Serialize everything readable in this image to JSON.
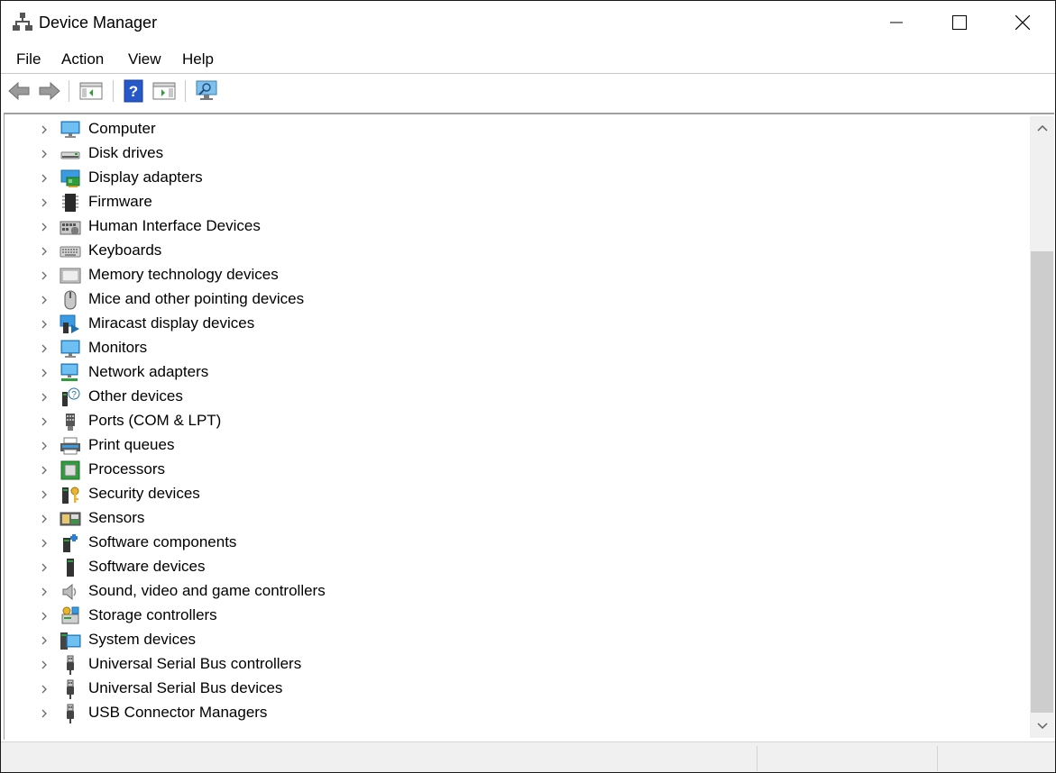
{
  "window": {
    "title": "Device Manager"
  },
  "menu": {
    "file": "File",
    "action": "Action",
    "view": "View",
    "help": "Help"
  },
  "icons": {
    "app": "device-manager-icon",
    "toolbar": [
      "back-arrow-icon",
      "forward-arrow-icon",
      "show-hide-console-tree-icon",
      "help-icon",
      "action-pane-icon",
      "scan-hardware-changes-icon"
    ]
  },
  "colors": {
    "thumb": "#cdcdcd",
    "scroll_track": "#f0f0f0",
    "icon_blue": "#2b7cd3"
  },
  "tree": {
    "items": [
      {
        "label": "Computer",
        "icon": "computer"
      },
      {
        "label": "Disk drives",
        "icon": "disk"
      },
      {
        "label": "Display adapters",
        "icon": "display-adapter"
      },
      {
        "label": "Firmware",
        "icon": "chip"
      },
      {
        "label": "Human Interface Devices",
        "icon": "hid"
      },
      {
        "label": "Keyboards",
        "icon": "keyboard"
      },
      {
        "label": "Memory technology devices",
        "icon": "memory"
      },
      {
        "label": "Mice and other pointing devices",
        "icon": "mouse"
      },
      {
        "label": "Miracast display devices",
        "icon": "miracast"
      },
      {
        "label": "Monitors",
        "icon": "monitor"
      },
      {
        "label": "Network adapters",
        "icon": "network"
      },
      {
        "label": "Other devices",
        "icon": "other"
      },
      {
        "label": "Ports (COM & LPT)",
        "icon": "port"
      },
      {
        "label": "Print queues",
        "icon": "printer"
      },
      {
        "label": "Processors",
        "icon": "processor"
      },
      {
        "label": "Security devices",
        "icon": "security"
      },
      {
        "label": "Sensors",
        "icon": "sensor"
      },
      {
        "label": "Software components",
        "icon": "software-component"
      },
      {
        "label": "Software devices",
        "icon": "software-device"
      },
      {
        "label": "Sound, video and game controllers",
        "icon": "sound"
      },
      {
        "label": "Storage controllers",
        "icon": "storage"
      },
      {
        "label": "System devices",
        "icon": "system"
      },
      {
        "label": "Universal Serial Bus controllers",
        "icon": "usb"
      },
      {
        "label": "Universal Serial Bus devices",
        "icon": "usb"
      },
      {
        "label": "USB Connector Managers",
        "icon": "usb"
      }
    ]
  }
}
